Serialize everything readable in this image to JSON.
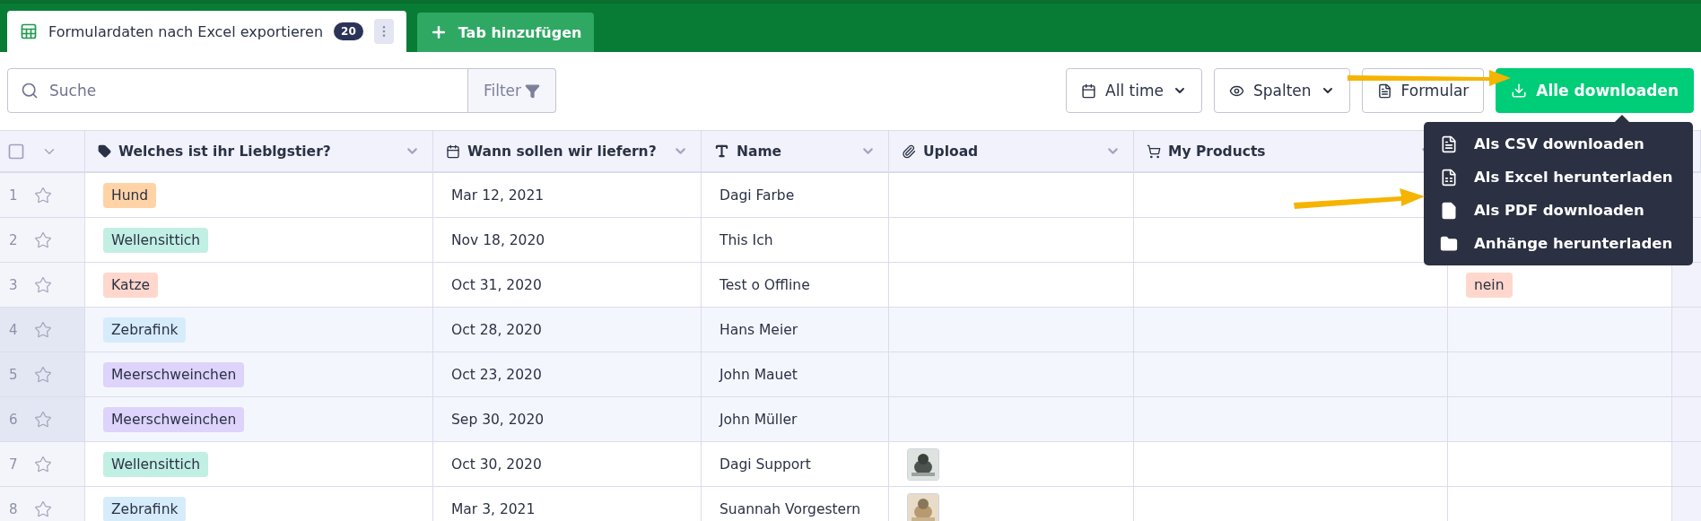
{
  "tabs": [
    {
      "kind": "sheet",
      "label": "Formulardaten nach Excel exportieren",
      "count": "20",
      "selected": true
    },
    {
      "kind": "add",
      "label": "Tab hinzufügen",
      "selected": false
    }
  ],
  "toolbar": {
    "search": {
      "placeholder": "Suche"
    },
    "filter": "Filter",
    "buttons": [
      {
        "kind": "calendar",
        "label": "All time",
        "dropdown": true
      },
      {
        "kind": "eye",
        "label": "Spalten",
        "dropdown": true
      },
      {
        "kind": "form",
        "label": "Formular",
        "dropdown": false
      },
      {
        "kind": "download",
        "label": "Alle downloaden",
        "dropdown": false
      }
    ]
  },
  "download_menu": [
    {
      "kind": "csv",
      "label": "Als CSV downloaden"
    },
    {
      "kind": "xls",
      "label": "Als Excel herunterladen"
    },
    {
      "kind": "pdf",
      "label": "Als PDF downloaden"
    },
    {
      "kind": "folder",
      "label": "Anhänge herunterladen"
    }
  ],
  "table": {
    "columns": [
      {
        "kind": "tag",
        "label": "Welches ist ihr Lieblgstier?"
      },
      {
        "kind": "calendar",
        "label": "Wann sollen wir liefern?"
      },
      {
        "kind": "text",
        "label": "Name"
      },
      {
        "kind": "clip",
        "label": "Upload"
      },
      {
        "kind": "cart",
        "label": "My Products"
      },
      {
        "kind": "none"
      }
    ],
    "select_all": {
      "checked": false
    },
    "rows": [
      {
        "number": "1",
        "selected": false,
        "cells": [
          {
            "text": "Hund",
            "color": "#ffd3a6"
          },
          {
            "text": "Mar 12, 2021"
          },
          {
            "text": "Dagi Farbe"
          },
          {},
          {},
          {}
        ]
      },
      {
        "number": "2",
        "selected": false,
        "cells": [
          {
            "text": "Wellensittich",
            "color": "#c2efe4"
          },
          {
            "text": "Nov 18, 2020"
          },
          {
            "text": "This Ich"
          },
          {},
          {},
          {}
        ]
      },
      {
        "number": "3",
        "selected": false,
        "cells": [
          {
            "text": "Katze",
            "color": "#ffd7cc"
          },
          {
            "text": "Oct 31, 2020"
          },
          {
            "text": "Test o Offline"
          },
          {},
          {},
          {
            "text": "nein",
            "color": "#ffd7cc"
          }
        ]
      },
      {
        "number": "4",
        "selected": true,
        "cells": [
          {
            "text": "Zebrafink",
            "color": "#d6ecfb"
          },
          {
            "text": "Oct 28, 2020"
          },
          {
            "text": "Hans Meier"
          },
          {},
          {},
          {}
        ]
      },
      {
        "number": "5",
        "selected": true,
        "cells": [
          {
            "text": "Meerschweinchen",
            "color": "#ddd3fb"
          },
          {
            "text": "Oct 23, 2020"
          },
          {
            "text": "John Mauet"
          },
          {},
          {},
          {}
        ]
      },
      {
        "number": "6",
        "selected": true,
        "cells": [
          {
            "text": "Meerschweinchen",
            "color": "#ddd3fb"
          },
          {
            "text": "Sep 30, 2020"
          },
          {
            "text": "John Müller"
          },
          {},
          {},
          {}
        ]
      },
      {
        "number": "7",
        "selected": false,
        "cells": [
          {
            "text": "Wellensittich",
            "color": "#c2efe4"
          },
          {
            "text": "Oct 30, 2020"
          },
          {
            "text": "Dagi Support"
          },
          {
            "kind": "picture"
          },
          {},
          {}
        ]
      },
      {
        "number": "8",
        "selected": false,
        "cells": [
          {
            "text": "Zebrafink",
            "color": "#d6ecfb"
          },
          {
            "text": "Mar 3, 2021"
          },
          {
            "text": "Suannah Vorgestern"
          },
          {
            "kind": "picture"
          },
          {},
          {}
        ]
      }
    ]
  }
}
